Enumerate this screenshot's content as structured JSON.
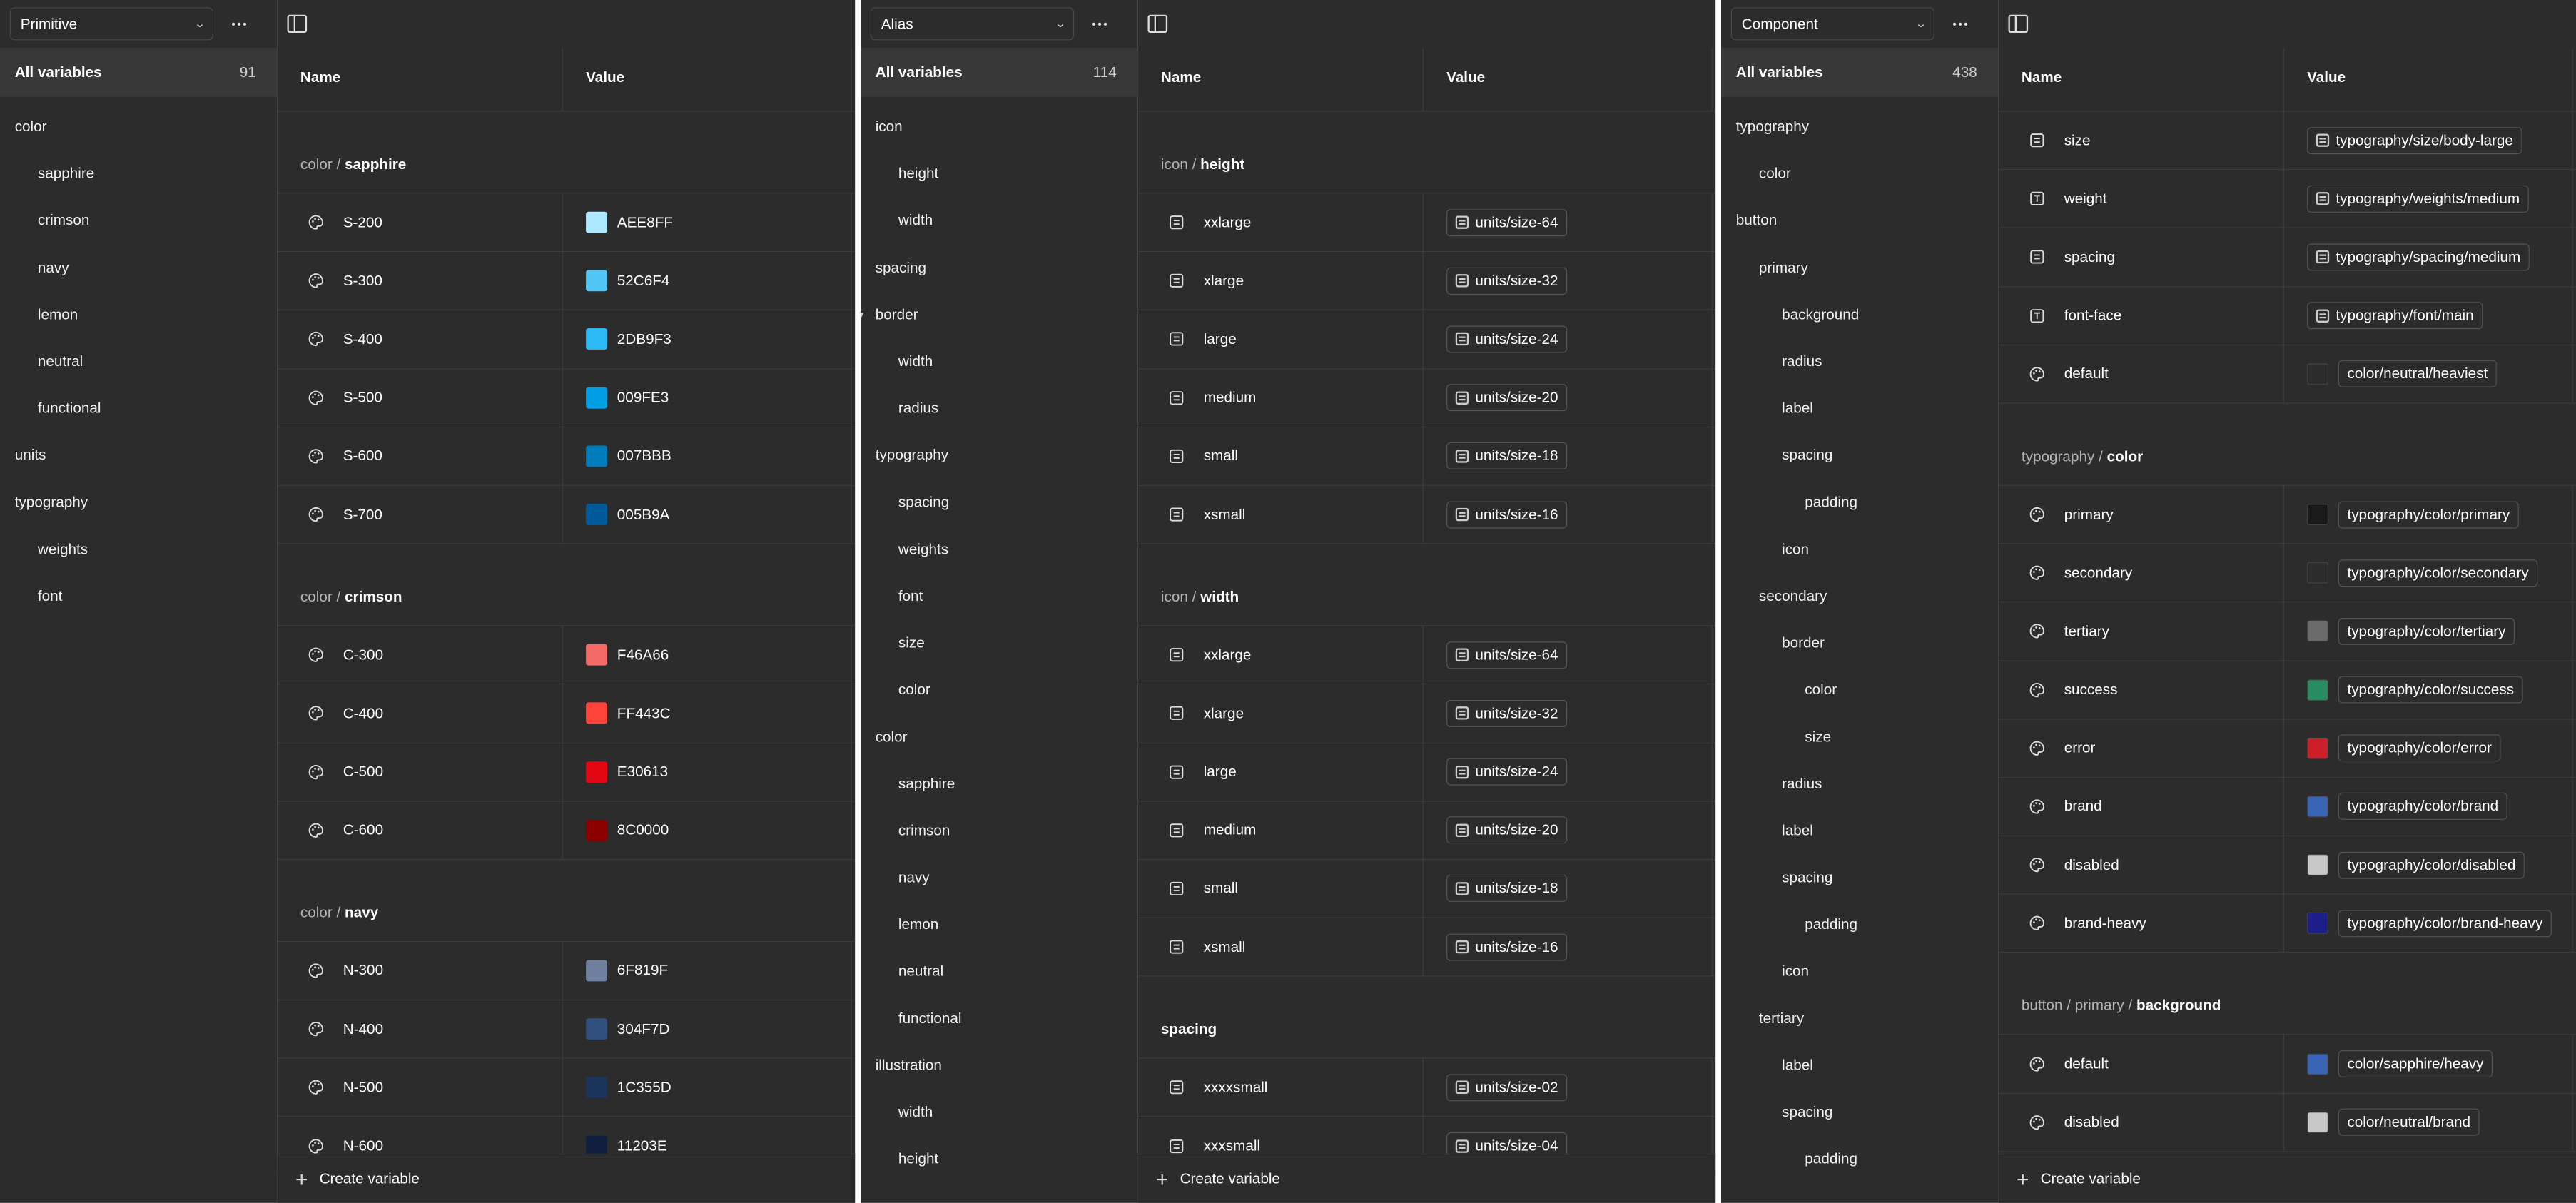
{
  "panels": [
    {
      "mode": "Primitive",
      "all_variables_label": "All variables",
      "count": "91",
      "groups": [
        {
          "label": "color",
          "indent": 0
        },
        {
          "label": "sapphire",
          "indent": 1
        },
        {
          "label": "crimson",
          "indent": 1
        },
        {
          "label": "navy",
          "indent": 1
        },
        {
          "label": "lemon",
          "indent": 1
        },
        {
          "label": "neutral",
          "indent": 1
        },
        {
          "label": "functional",
          "indent": 1
        },
        {
          "label": "units",
          "indent": 0
        },
        {
          "label": "typography",
          "indent": 0
        },
        {
          "label": "weights",
          "indent": 1
        },
        {
          "label": "font",
          "indent": 1
        }
      ],
      "columns": {
        "name": "Name",
        "value": "Value"
      },
      "sections": [
        {
          "prefix": "color / ",
          "title": "sapphire",
          "rows": [
            {
              "icon": "palette",
              "name": "S-200",
              "kind": "color",
              "color": "#AEE8FF",
              "value": "AEE8FF"
            },
            {
              "icon": "palette",
              "name": "S-300",
              "kind": "color",
              "color": "#52C6F4",
              "value": "52C6F4"
            },
            {
              "icon": "palette",
              "name": "S-400",
              "kind": "color",
              "color": "#2DB9F3",
              "value": "2DB9F3"
            },
            {
              "icon": "palette",
              "name": "S-500",
              "kind": "color",
              "color": "#009FE3",
              "value": "009FE3"
            },
            {
              "icon": "palette",
              "name": "S-600",
              "kind": "color",
              "color": "#007BBB",
              "value": "007BBB"
            },
            {
              "icon": "palette",
              "name": "S-700",
              "kind": "color",
              "color": "#005B9A",
              "value": "005B9A"
            }
          ]
        },
        {
          "prefix": "color / ",
          "title": "crimson",
          "rows": [
            {
              "icon": "palette",
              "name": "C-300",
              "kind": "color",
              "color": "#F46A66",
              "value": "F46A66"
            },
            {
              "icon": "palette",
              "name": "C-400",
              "kind": "color",
              "color": "#FF443C",
              "value": "FF443C"
            },
            {
              "icon": "palette",
              "name": "C-500",
              "kind": "color",
              "color": "#E30613",
              "value": "E30613"
            },
            {
              "icon": "palette",
              "name": "C-600",
              "kind": "color",
              "color": "#8C0000",
              "value": "8C0000"
            }
          ]
        },
        {
          "prefix": "color / ",
          "title": "navy",
          "rows": [
            {
              "icon": "palette",
              "name": "N-300",
              "kind": "color",
              "color": "#6F819F",
              "value": "6F819F"
            },
            {
              "icon": "palette",
              "name": "N-400",
              "kind": "color",
              "color": "#304F7D",
              "value": "304F7D"
            },
            {
              "icon": "palette",
              "name": "N-500",
              "kind": "color",
              "color": "#1C355D",
              "value": "1C355D"
            },
            {
              "icon": "palette",
              "name": "N-600",
              "kind": "color",
              "color": "#11203E",
              "value": "11203E"
            }
          ]
        }
      ],
      "create_label": "Create variable"
    },
    {
      "mode": "Alias",
      "all_variables_label": "All variables",
      "count": "114",
      "groups": [
        {
          "label": "icon",
          "indent": 0
        },
        {
          "label": "height",
          "indent": 1
        },
        {
          "label": "width",
          "indent": 1
        },
        {
          "label": "spacing",
          "indent": 0
        },
        {
          "label": "border",
          "indent": 0,
          "caret": true
        },
        {
          "label": "width",
          "indent": 1
        },
        {
          "label": "radius",
          "indent": 1
        },
        {
          "label": "typography",
          "indent": 0
        },
        {
          "label": "spacing",
          "indent": 1
        },
        {
          "label": "weights",
          "indent": 1
        },
        {
          "label": "font",
          "indent": 1
        },
        {
          "label": "size",
          "indent": 1
        },
        {
          "label": "color",
          "indent": 1
        },
        {
          "label": "color",
          "indent": 0
        },
        {
          "label": "sapphire",
          "indent": 1
        },
        {
          "label": "crimson",
          "indent": 1
        },
        {
          "label": "navy",
          "indent": 1
        },
        {
          "label": "lemon",
          "indent": 1
        },
        {
          "label": "neutral",
          "indent": 1
        },
        {
          "label": "functional",
          "indent": 1
        },
        {
          "label": "illustration",
          "indent": 0
        },
        {
          "label": "width",
          "indent": 1
        },
        {
          "label": "height",
          "indent": 1
        }
      ],
      "columns": {
        "name": "Name",
        "value": "Value"
      },
      "sections": [
        {
          "prefix": "icon / ",
          "title": "height",
          "rows": [
            {
              "icon": "number",
              "name": "xxlarge",
              "kind": "alias",
              "value": "units/size-64"
            },
            {
              "icon": "number",
              "name": "xlarge",
              "kind": "alias",
              "value": "units/size-32"
            },
            {
              "icon": "number",
              "name": "large",
              "kind": "alias",
              "value": "units/size-24"
            },
            {
              "icon": "number",
              "name": "medium",
              "kind": "alias",
              "value": "units/size-20"
            },
            {
              "icon": "number",
              "name": "small",
              "kind": "alias",
              "value": "units/size-18"
            },
            {
              "icon": "number",
              "name": "xsmall",
              "kind": "alias",
              "value": "units/size-16"
            }
          ]
        },
        {
          "prefix": "icon / ",
          "title": "width",
          "rows": [
            {
              "icon": "number",
              "name": "xxlarge",
              "kind": "alias",
              "value": "units/size-64"
            },
            {
              "icon": "number",
              "name": "xlarge",
              "kind": "alias",
              "value": "units/size-32"
            },
            {
              "icon": "number",
              "name": "large",
              "kind": "alias",
              "value": "units/size-24"
            },
            {
              "icon": "number",
              "name": "medium",
              "kind": "alias",
              "value": "units/size-20"
            },
            {
              "icon": "number",
              "name": "small",
              "kind": "alias",
              "value": "units/size-18"
            },
            {
              "icon": "number",
              "name": "xsmall",
              "kind": "alias",
              "value": "units/size-16"
            }
          ]
        },
        {
          "prefix": "",
          "title": "spacing",
          "rows": [
            {
              "icon": "number",
              "name": "xxxxsmall",
              "kind": "alias",
              "value": "units/size-02"
            },
            {
              "icon": "number",
              "name": "xxxsmall",
              "kind": "alias",
              "value": "units/size-04"
            }
          ]
        }
      ],
      "create_label": "Create variable"
    },
    {
      "mode": "Component",
      "all_variables_label": "All variables",
      "count": "438",
      "groups": [
        {
          "label": "typography",
          "indent": 0
        },
        {
          "label": "color",
          "indent": 1
        },
        {
          "label": "button",
          "indent": 0
        },
        {
          "label": "primary",
          "indent": 1
        },
        {
          "label": "background",
          "indent": 2
        },
        {
          "label": "radius",
          "indent": 2
        },
        {
          "label": "label",
          "indent": 2
        },
        {
          "label": "spacing",
          "indent": 2
        },
        {
          "label": "padding",
          "indent": 3
        },
        {
          "label": "icon",
          "indent": 2
        },
        {
          "label": "secondary",
          "indent": 1
        },
        {
          "label": "border",
          "indent": 2
        },
        {
          "label": "color",
          "indent": 3
        },
        {
          "label": "size",
          "indent": 3
        },
        {
          "label": "radius",
          "indent": 2
        },
        {
          "label": "label",
          "indent": 2
        },
        {
          "label": "spacing",
          "indent": 2
        },
        {
          "label": "padding",
          "indent": 3
        },
        {
          "label": "icon",
          "indent": 2
        },
        {
          "label": "tertiary",
          "indent": 1
        },
        {
          "label": "label",
          "indent": 2
        },
        {
          "label": "spacing",
          "indent": 2
        },
        {
          "label": "padding",
          "indent": 3
        }
      ],
      "columns": {
        "name": "Name",
        "value": "Value"
      },
      "sections": [
        {
          "prefix": "",
          "title": "",
          "rows": [
            {
              "icon": "number",
              "name": "size",
              "kind": "alias",
              "value": "typography/size/body-large"
            },
            {
              "icon": "text",
              "name": "weight",
              "kind": "alias",
              "value": "typography/weights/medium"
            },
            {
              "icon": "number",
              "name": "spacing",
              "kind": "alias",
              "value": "typography/spacing/medium"
            },
            {
              "icon": "text",
              "name": "font-face",
              "kind": "alias",
              "value": "typography/font/main"
            },
            {
              "icon": "palette",
              "name": "default",
              "kind": "coloralias",
              "color": "#2c2c2c",
              "value": "color/neutral/heaviest"
            }
          ]
        },
        {
          "prefix": "typography / ",
          "title": "color",
          "rows": [
            {
              "icon": "palette",
              "name": "primary",
              "kind": "coloralias",
              "color": "#1a1a1a",
              "value": "typography/color/primary"
            },
            {
              "icon": "palette",
              "name": "secondary",
              "kind": "coloralias",
              "color": "#2c2c2c",
              "value": "typography/color/secondary"
            },
            {
              "icon": "palette",
              "name": "tertiary",
              "kind": "coloralias",
              "color": "#6b6b6b",
              "value": "typography/color/tertiary"
            },
            {
              "icon": "palette",
              "name": "success",
              "kind": "coloralias",
              "color": "#2a8c62",
              "value": "typography/color/success"
            },
            {
              "icon": "palette",
              "name": "error",
              "kind": "coloralias",
              "color": "#cc1f2a",
              "value": "typography/color/error"
            },
            {
              "icon": "palette",
              "name": "brand",
              "kind": "coloralias",
              "color": "#3a64b5",
              "value": "typography/color/brand"
            },
            {
              "icon": "palette",
              "name": "disabled",
              "kind": "coloralias",
              "color": "#c8c8c8",
              "value": "typography/color/disabled"
            },
            {
              "icon": "palette",
              "name": "brand-heavy",
              "kind": "coloralias",
              "color": "#1d1f8a",
              "value": "typography/color/brand-heavy"
            }
          ]
        },
        {
          "prefix": "button / primary / ",
          "title": "background",
          "rows": [
            {
              "icon": "palette",
              "name": "default",
              "kind": "coloralias",
              "color": "#3a64b5",
              "value": "color/sapphire/heavy"
            },
            {
              "icon": "palette",
              "name": "disabled",
              "kind": "coloralias",
              "color": "#c8c8c8",
              "value": "color/neutral/brand"
            }
          ]
        }
      ],
      "create_label": "Create variable"
    }
  ]
}
